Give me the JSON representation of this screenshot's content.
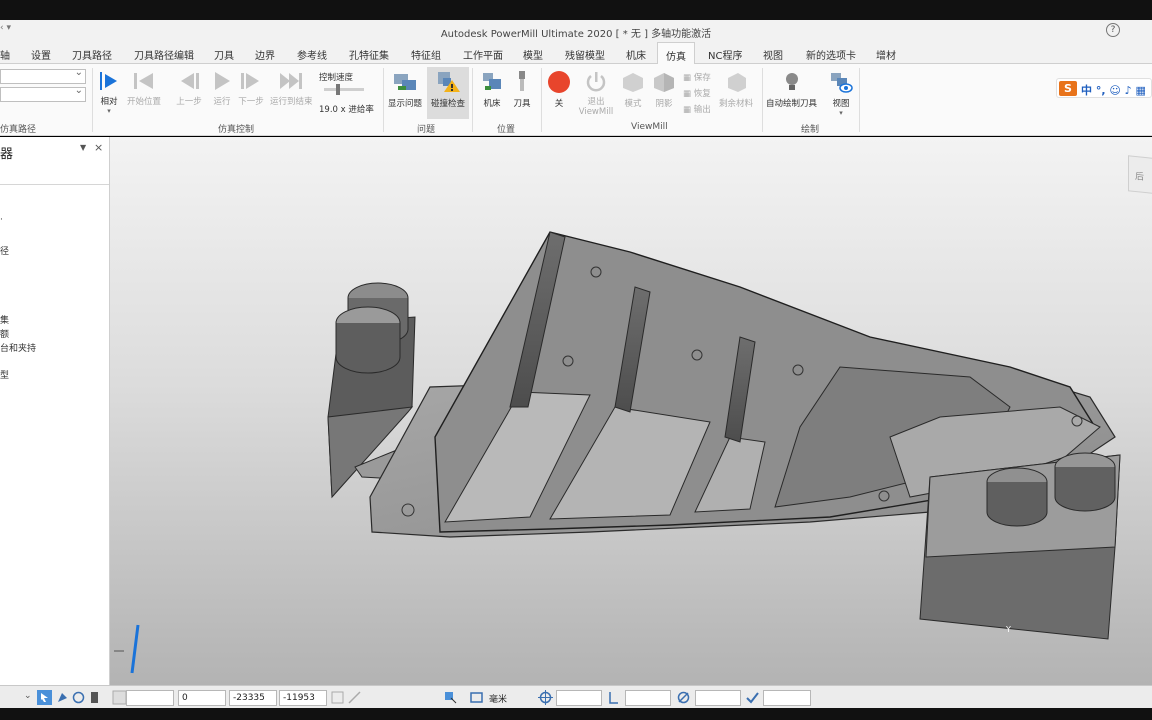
{
  "window": {
    "title": "Autodesk PowerMill Ultimate 2020    [ * 无 ]    多轴功能激活",
    "qat": "‹ ▾",
    "help": "?"
  },
  "tabs": [
    "设置",
    "刀具路径",
    "刀具路径编辑",
    "刀具",
    "边界",
    "参考线",
    "孔特征集",
    "特征组",
    "工作平面",
    "模型",
    "残留模型",
    "机床",
    "仿真",
    "NC程序",
    "视图",
    "新的选项卡",
    "增材"
  ],
  "active_tab": "仿真",
  "ribbon": {
    "left_label": "仿真路径",
    "sim_buttons": [
      "开始位置",
      "上一步",
      "运行",
      "下一步",
      "运行到结束"
    ],
    "relative_label": "相对",
    "speed_title": "控制速度",
    "speed_value": "19.0 x 进给率",
    "sim_group": "仿真控制",
    "problem_buttons": [
      "显示问题",
      "碰撞检查"
    ],
    "problem_group": "问题",
    "position_buttons": [
      "机床",
      "刀具"
    ],
    "position_group": "位置",
    "viewmill_buttons": [
      "关",
      "退出 ViewMill",
      "模式",
      "阴影"
    ],
    "viewmill_small": [
      "保存",
      "恢复",
      "输出"
    ],
    "viewmill_remaining": "剩余材料",
    "viewmill_group": "ViewMill",
    "draw_buttons": [
      "自动绘制刀具",
      "视图"
    ],
    "draw_group": "绘制"
  },
  "ime": {
    "logo": "S",
    "text": "中 °, ☺ ♪ ▦"
  },
  "explorer": {
    "title": "器",
    "items": [
      "·",
      "径",
      "集",
      "额",
      "台和夹持",
      "型"
    ]
  },
  "viewport": {
    "viewcube_label": "后",
    "axis_label": "Y"
  },
  "status": {
    "field0": "0",
    "field1": "-23335",
    "field2": "-11953",
    "unit": "毫米"
  },
  "colors": {
    "accent": "#1a73d9",
    "stop": "#e8452c",
    "viewport_top": "#f3f3f3",
    "viewport_bottom": "#b3b3b3"
  }
}
